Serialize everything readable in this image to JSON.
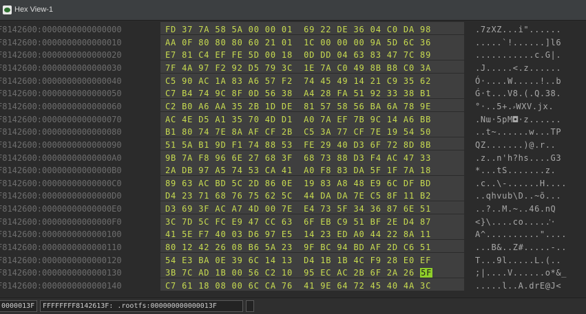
{
  "window": {
    "title": "Hex View-1",
    "icon": "ida-icon"
  },
  "rows": [
    {
      "address": "F8142600:0000000000000000",
      "hex": "FD 37 7A 58 5A 00 00 01  69 22 DE 36 04 C0 DA 98",
      "ascii": ".7zXZ...i\"......"
    },
    {
      "address": "F8142600:0000000000000010",
      "hex": "AA 0F 80 80 80 60 21 01  1C 00 00 00 9A 5D 6C 36",
      "ascii": ".....`!......]l6"
    },
    {
      "address": "F8142600:0000000000000020",
      "hex": "E7 81 C4 EF FE 5D 00 18  0D DD 04 63 83 47 7C 89",
      "ascii": "...........c.G|."
    },
    {
      "address": "F8142600:0000000000000030",
      "hex": "7F 4A 97 F2 92 D5 79 3C  1E 7A C0 49 8B B8 C0 3A",
      "ascii": ".J.....<.z......"
    },
    {
      "address": "F8142600:0000000000000040",
      "hex": "C5 90 AC 1A 83 A6 57 F2  74 45 49 14 21 C9 35 62",
      "ascii": "Ó·....W.....!..b"
    },
    {
      "address": "F8142600:0000000000000050",
      "hex": "C7 B4 74 9C 8F 0D 56 38  A4 28 FA 51 92 33 38 B1",
      "ascii": "Ǵ·t...V8.(.Q.38."
    },
    {
      "address": "F8142600:0000000000000060",
      "hex": "C2 B0 A6 AA 35 2B 1D DE  81 57 58 56 BA 6A 78 9E",
      "ascii": "°·..5+.⸗WXV.jx."
    },
    {
      "address": "F8142600:0000000000000070",
      "hex": "AC 4E D5 A1 35 70 4D D1  A0 7A EF 7B 9C 14 A6 BB",
      "ascii": ".Nա·5pM◘·z......"
    },
    {
      "address": "F8142600:0000000000000080",
      "hex": "B1 80 74 7E 8A AF CF 2B  C5 3A 77 CF 7E 19 54 50",
      "ascii": "..t~......w...TP"
    },
    {
      "address": "F8142600:0000000000000090",
      "hex": "51 5A B1 9D F1 74 88 53  FE 29 40 D3 6F 72 8D 8B",
      "ascii": "QZ.......)@.r.."
    },
    {
      "address": "F8142600:00000000000000A0",
      "hex": "9B 7A F8 96 6E 27 68 3F  68 73 88 D3 F4 AC 47 33",
      "ascii": ".z..n'h?hs....G3"
    },
    {
      "address": "F8142600:00000000000000B0",
      "hex": "2A DB 97 A5 74 53 CA 41  A0 F8 83 DA 5F 1F 7A 18",
      "ascii": "*...tS.......z."
    },
    {
      "address": "F8142600:00000000000000C0",
      "hex": "89 63 AC BD 5C 2D 86 0E  19 83 A8 48 E9 6C DF BD",
      "ascii": ".c..\\-......H...."
    },
    {
      "address": "F8142600:00000000000000D0",
      "hex": "D4 23 71 68 76 75 62 5C  44 DA DA 7E C5 8F 11 B2",
      "ascii": "..qhvub\\D..~õ..."
    },
    {
      "address": "F8142600:00000000000000E0",
      "hex": "D3 69 3F AC A7 4D 00 7E  E4 73 5F 34 36 87 6E 51",
      "ascii": "..?..M.~..46.nQ"
    },
    {
      "address": "F8142600:00000000000000F0",
      "hex": "3C 7D 5C FC E9 47 CC 63  6F EB C9 51 BF 2E D4 87",
      "ascii": "<}\\....co.....ᡃ·"
    },
    {
      "address": "F8142600:0000000000000100",
      "hex": "41 5E F7 40 03 D6 97 E5  14 23 ED A0 44 22 8A 11",
      "ascii": "A^..........\"...."
    },
    {
      "address": "F8142600:0000000000000110",
      "hex": "80 12 42 26 08 B6 5A 23  9F BC 94 BD AF 2D C6 51",
      "ascii": "...B&..Z#.....-.."
    },
    {
      "address": "F8142600:0000000000000120",
      "hex": "54 E3 BA 0E 39 6C 14 13  D4 1B 1B 4C F9 28 E0 EF",
      "ascii": "T...9l.....L.(.."
    },
    {
      "address": "F8142600:0000000000000130",
      "hex": "3B 7C AD 1B 00 56 C2 10  95 EC AC 2B 6F 2A 26 ",
      "hex_highlight": "5F",
      "ascii": ";|....V......o*&_"
    },
    {
      "address": "F8142600:0000000000000140",
      "hex": "C7 61 18 08 00 6C CA 76  41 9E 64 72 45 40 4A 3C",
      "ascii": ".....l..A.drE@J<"
    }
  ],
  "status": {
    "offset": "0000013F",
    "location": "FFFFFFFF8142613F: .rootfs:000000000000013F",
    "extra": ""
  }
}
